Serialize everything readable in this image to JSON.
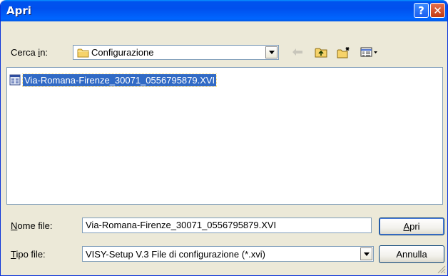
{
  "window": {
    "title": "Apri",
    "help_label": "?",
    "close_label": "✕"
  },
  "toolbar": {
    "lookin_label_pre": "Cerca ",
    "lookin_label_key": "i",
    "lookin_label_post": "n:",
    "lookin_value": "Configurazione",
    "icons": [
      "back-arrow-icon",
      "up-folder-icon",
      "new-folder-icon",
      "view-menu-icon"
    ]
  },
  "files": [
    {
      "name": "Via-Romana-Firenze_30071_0556795879.XVI",
      "selected": true,
      "icon": "xvi-file-icon"
    }
  ],
  "filename": {
    "label_key": "N",
    "label_rest": "ome file:",
    "value": "Via-Romana-Firenze_30071_0556795879.XVI"
  },
  "filetype": {
    "label_key": "T",
    "label_rest": "ipo file:",
    "value": "VISY-Setup V.3 File di configurazione (*.xvi)"
  },
  "buttons": {
    "open_key": "A",
    "open_rest": "pri",
    "cancel": "Annulla"
  }
}
